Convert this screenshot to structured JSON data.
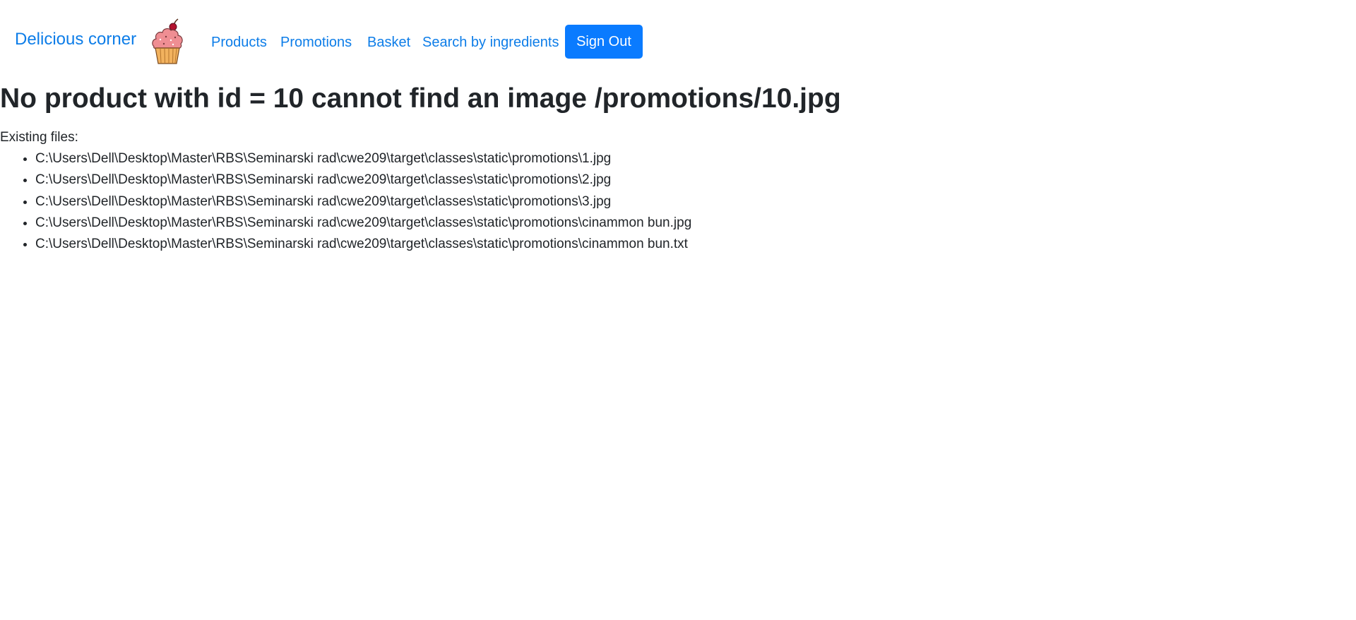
{
  "header": {
    "brand": "Delicious corner",
    "logo_icon": "cupcake-icon",
    "nav": {
      "products": "Products",
      "promotions": "Promotions",
      "basket": "Basket",
      "search": "Search by ingredients"
    },
    "signout_label": "Sign Out"
  },
  "main": {
    "title": "No product with id = 10 cannot find an image /promotions/10.jpg",
    "existing_label": "Existing files:",
    "files": [
      "C:\\Users\\Dell\\Desktop\\Master\\RBS\\Seminarski rad\\cwe209\\target\\classes\\static\\promotions\\1.jpg",
      "C:\\Users\\Dell\\Desktop\\Master\\RBS\\Seminarski rad\\cwe209\\target\\classes\\static\\promotions\\2.jpg",
      "C:\\Users\\Dell\\Desktop\\Master\\RBS\\Seminarski rad\\cwe209\\target\\classes\\static\\promotions\\3.jpg",
      "C:\\Users\\Dell\\Desktop\\Master\\RBS\\Seminarski rad\\cwe209\\target\\classes\\static\\promotions\\cinammon bun.jpg",
      "C:\\Users\\Dell\\Desktop\\Master\\RBS\\Seminarski rad\\cwe209\\target\\classes\\static\\promotions\\cinammon bun.txt"
    ]
  },
  "colors": {
    "link": "#0d7de8",
    "button": "#0a7bff",
    "text": "#212529"
  }
}
